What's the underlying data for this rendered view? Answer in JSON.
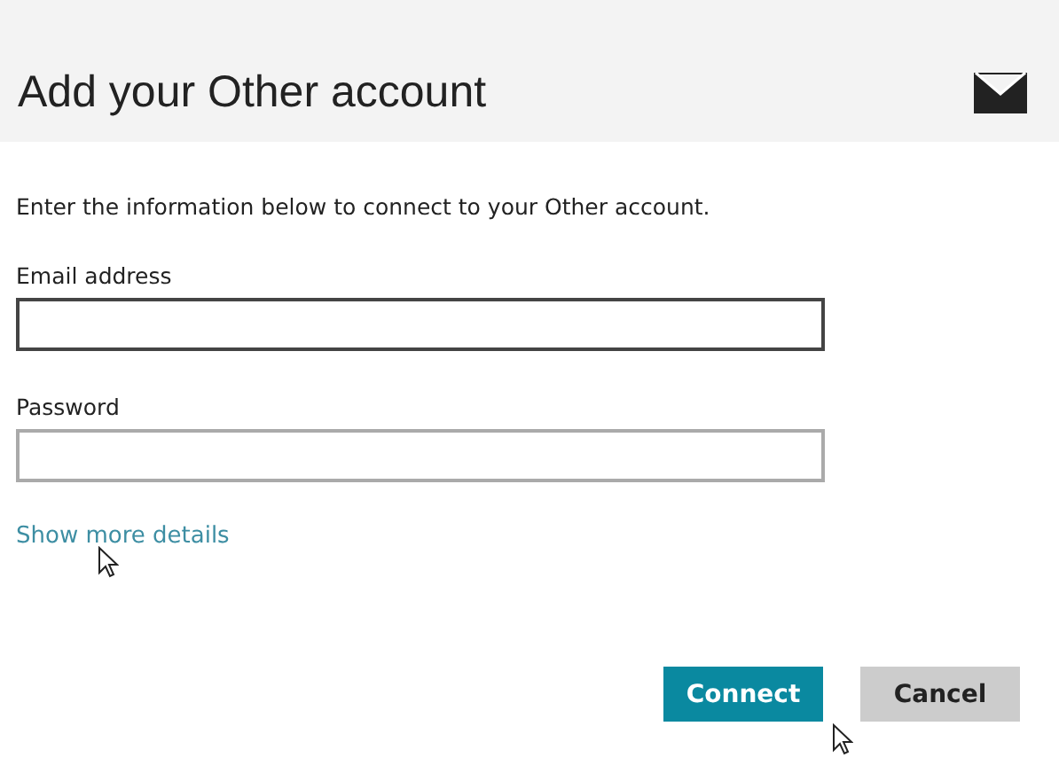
{
  "header": {
    "title": "Add your Other account"
  },
  "intro": "Enter the information below to connect to your Other account.",
  "fields": [
    {
      "label": "Email address",
      "focused": true
    },
    {
      "label": "Password",
      "focused": false
    }
  ],
  "link": "Show more details",
  "buttons": [
    {
      "label": "Connect",
      "kind": "primary"
    },
    {
      "label": "Cancel",
      "kind": "secondary"
    }
  ]
}
